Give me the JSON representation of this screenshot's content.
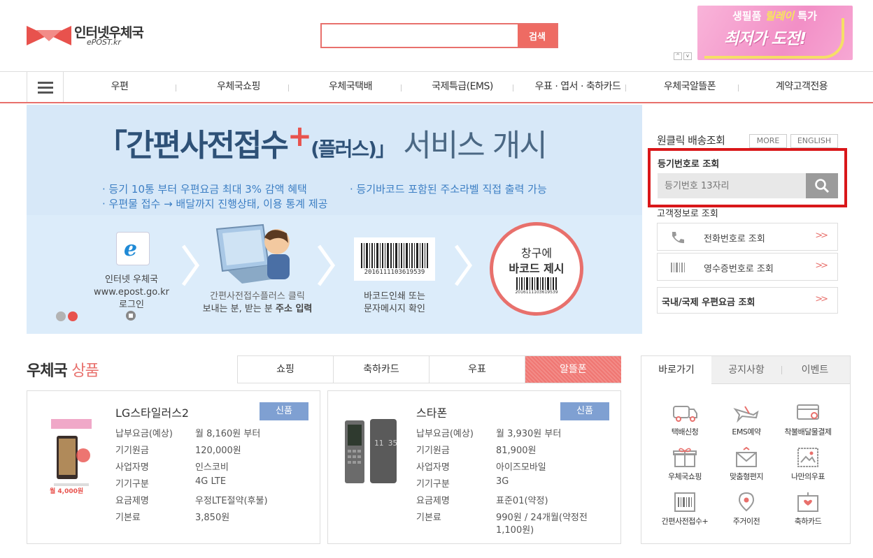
{
  "header": {
    "logo_name": "인터넷우체국",
    "logo_sub": "ePOST.kr",
    "search_value": "",
    "search_button": "검색",
    "ad_line1_a": "생필품",
    "ad_line1_b": "릴레이",
    "ad_line1_c": "특가",
    "ad_line2": "최저가 도전!",
    "ad_prev": "^",
    "ad_next": "v"
  },
  "nav": {
    "items": [
      "우편",
      "우체국쇼핑",
      "우체국택배",
      "국제특급(EMS)",
      "우표 · 엽서 · 축하카드",
      "우체국알뜰폰",
      "계약고객전용"
    ]
  },
  "hero": {
    "title_open": "「간편사전접수",
    "title_plus": "+",
    "title_paren": "(플러스)」",
    "title_rest": "서비스 개시",
    "bullet1": "· 등기 10통 부터 우편요금 최대 3% 감액 혜택",
    "bullet2": "· 우편물 접수 → 배달까지 진행상태, 이용 통계 제공",
    "bullet3": "· 등기바코드 포함된 주소라벨 직접 출력 가능",
    "step1_l1": "인터넷 우체국",
    "step1_l2": "www.epost.go.kr",
    "step1_l3": "로그인",
    "step2_l1": "간편사전접수플러스 클릭",
    "step2_l2a": "보내는 분, 받는 분 ",
    "step2_l2b": "주소 입력",
    "barcode_number": "2016111103619539",
    "step3_l1": "바코드인쇄 또는",
    "step3_l2": "문자메시지 확인",
    "stamp_l1": "창구에",
    "stamp_l2": "바코드 제시",
    "stamp_number": "2016111103619539"
  },
  "tracking": {
    "title": "원클릭 배송조회",
    "more": "MORE",
    "english": "ENGLISH",
    "label": "등기번호로 조회",
    "placeholder": "등기번호 13자리",
    "customer_title": "고객정보로 조회",
    "row_phone": "전화번호로 조회",
    "row_receipt": "영수증번호로 조회",
    "row_postage": "국내/국제 우편요금 조회",
    "chevrons": ">>"
  },
  "products": {
    "title_a": "우체국",
    "title_b": "상품",
    "tabs": [
      "쇼핑",
      "축하카드",
      "우표",
      "알뜰폰"
    ],
    "spec_labels": [
      "납부요금(예상)",
      "기기원금",
      "사업자명",
      "기기구분",
      "요금제명",
      "기본료"
    ],
    "card1": {
      "name": "LG스타일러스2",
      "badge": "신품",
      "values": [
        "월 8,160원 부터",
        "120,000원",
        "인스코비",
        "4G LTE",
        "우정LTE절약(후불)",
        "3,850원"
      ],
      "promo_price": "월 4,000원"
    },
    "card2": {
      "name": "스타폰",
      "badge": "신품",
      "values": [
        "월 3,930원 부터",
        "81,900원",
        "아이즈모바일",
        "3G",
        "표준01(약정)",
        "990원 / 24개월(약정전"
      ],
      "value_extra": "1,100원)",
      "clock": "11 35"
    }
  },
  "quick": {
    "tabs": [
      "바로가기",
      "공지사항",
      "이벤트"
    ],
    "items": [
      "택배신청",
      "EMS예약",
      "착불배달물결제",
      "우체국쇼핑",
      "맞춤형편지",
      "나만의우표",
      "간편사전접수+",
      "주거이전",
      "축하카드"
    ]
  },
  "colors": {
    "accent": "#e8706c",
    "highlight_box": "#d9171a",
    "badge": "#7fa0d2",
    "hero_bg": "#d7e8f8"
  }
}
